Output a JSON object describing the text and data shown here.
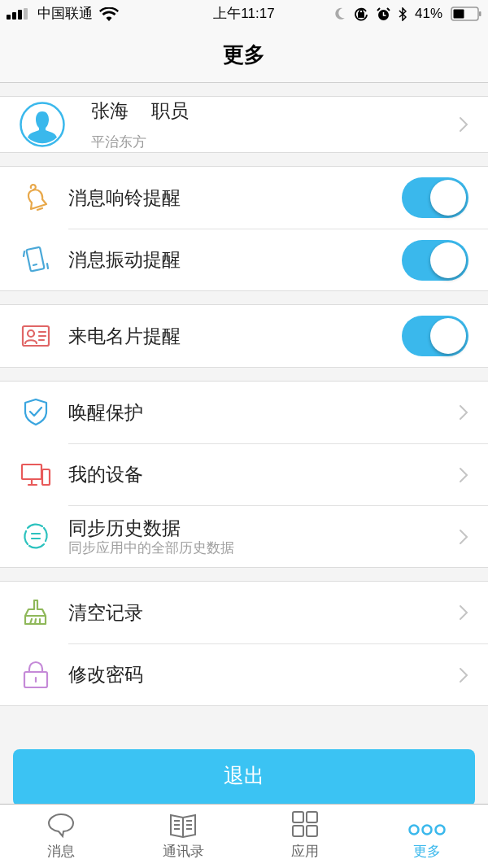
{
  "status_bar": {
    "carrier": "中国联通",
    "time": "上午11:17",
    "battery": "41%"
  },
  "nav_bar": {
    "title": "更多"
  },
  "profile": {
    "name": "张海",
    "role": "职员",
    "org": "平治东方"
  },
  "groups": [
    {
      "rows": [
        {
          "kind": "toggle",
          "label": "消息响铃提醒",
          "on": true
        },
        {
          "kind": "toggle",
          "label": "消息振动提醒",
          "on": true
        }
      ]
    },
    {
      "rows": [
        {
          "kind": "toggle",
          "label": "来电名片提醒",
          "on": true
        }
      ]
    },
    {
      "rows": [
        {
          "kind": "link",
          "label": "唤醒保护"
        },
        {
          "kind": "link",
          "label": "我的设备"
        },
        {
          "kind": "link",
          "label": "同步历史数据",
          "subtitle": "同步应用中的全部历史数据"
        }
      ]
    },
    {
      "rows": [
        {
          "kind": "link",
          "label": "清空记录"
        },
        {
          "kind": "link",
          "label": "修改密码"
        }
      ]
    }
  ],
  "logout_button": {
    "label": "退出"
  },
  "tab_bar": [
    {
      "label": "消息",
      "selected": false
    },
    {
      "label": "通讯录",
      "selected": false
    },
    {
      "label": "应用",
      "selected": false
    },
    {
      "label": "更多",
      "selected": true
    }
  ]
}
